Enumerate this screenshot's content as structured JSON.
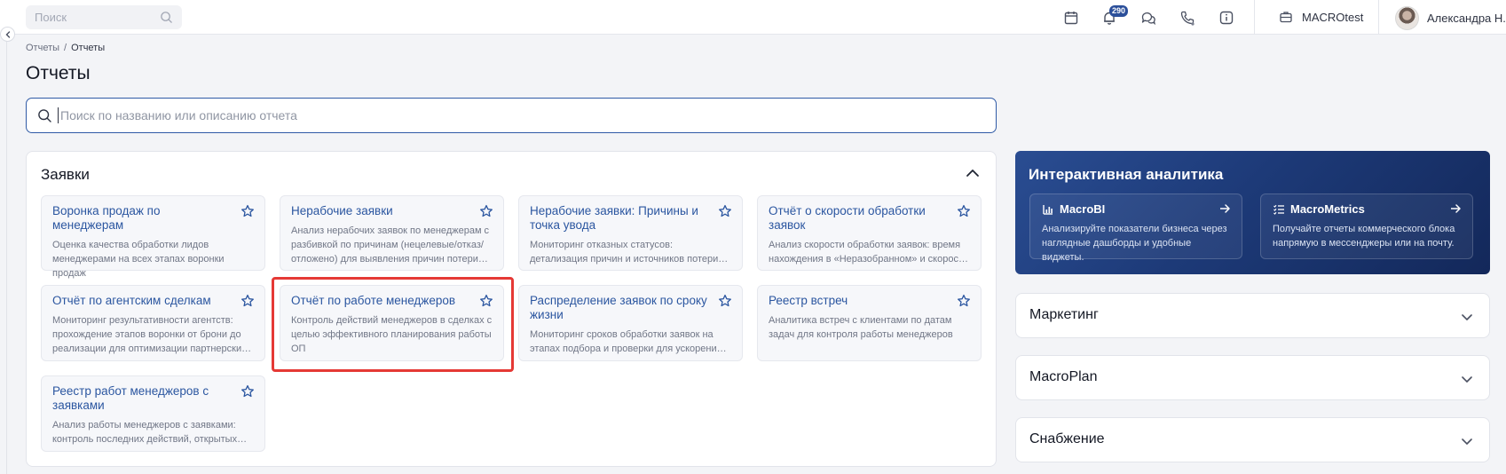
{
  "topbar": {
    "search_placeholder": "Поиск",
    "notifications_count": "290",
    "company": "MACROtest",
    "user_name": "Александра Н."
  },
  "breadcrumb": {
    "root": "Отчеты",
    "sep": "/",
    "current": "Отчеты"
  },
  "page_title": "Отчеты",
  "search": {
    "placeholder": "Поиск по названию или описанию отчета",
    "value": ""
  },
  "section": {
    "title": "Заявки",
    "cards": [
      {
        "title": "Воронка продаж по менеджерам",
        "desc": "Оценка качества обработки лидов менеджерами на всех этапах воронки продаж"
      },
      {
        "title": "Нерабочие заявки",
        "desc": "Анализ нерабочих заявок по менеджерам с разбивкой по причинам (нецелевые/отказ/отложено) для выявления причин потери клиентов"
      },
      {
        "title": "Нерабочие заявки: Причины и точка увода",
        "desc": "Мониторинг отказных статусов: детализация причин и источников потери заявок по этапам"
      },
      {
        "title": "Отчёт о скорости обработки заявок",
        "desc": "Анализ скорости обработки заявок: время нахождения в «Неразобранном» и скорость реакции менеджеров"
      },
      {
        "title": "Отчёт по агентским сделкам",
        "desc": "Мониторинг результативности агентств: прохождение этапов воронки от брони до реализации для оптимизации партнерских каналов"
      },
      {
        "title": "Отчёт по работе менеджеров",
        "desc": "Контроль действий менеджеров в сделках с целью эффективного планирования работы ОП"
      },
      {
        "title": "Распределение заявок по сроку жизни",
        "desc": "Мониторинг сроков обработки заявок на этапах подбора и проверки для ускорения их прохождения"
      },
      {
        "title": "Реестр встреч",
        "desc": "Аналитика встреч с клиентами по датам задач для контроля работы менеджеров"
      },
      {
        "title": "Реестр работ менеджеров с заявками",
        "desc": "Анализ работы менеджеров с заявками: контроль последних действий, открытых задач и сроков"
      }
    ]
  },
  "analytics": {
    "title": "Интерактивная аналитика",
    "macrobi": {
      "title": "MacroBI",
      "desc": "Анализируйте показатели бизнеса через наглядные дашборды и удобные виджеты."
    },
    "macrometrics": {
      "title": "MacroMetrics",
      "desc": "Получайте отчеты коммерческого блока напрямую в мессенджеры или на почту."
    }
  },
  "collapsed_sections": [
    {
      "title": "Маркетинг"
    },
    {
      "title": "MacroPlan"
    },
    {
      "title": "Снабжение"
    }
  ],
  "colors": {
    "accent": "#2b56a0",
    "highlight": "#e53935",
    "analytics_bg": "#1d3a78"
  },
  "icons": [
    "search-icon",
    "calendar-icon",
    "bell-icon",
    "chat-icon",
    "phone-icon",
    "info-icon",
    "briefcase-icon",
    "star-icon",
    "chevron-up-icon",
    "chevron-down-icon",
    "arrow-right-icon",
    "bar-chart-icon",
    "list-check-icon"
  ]
}
